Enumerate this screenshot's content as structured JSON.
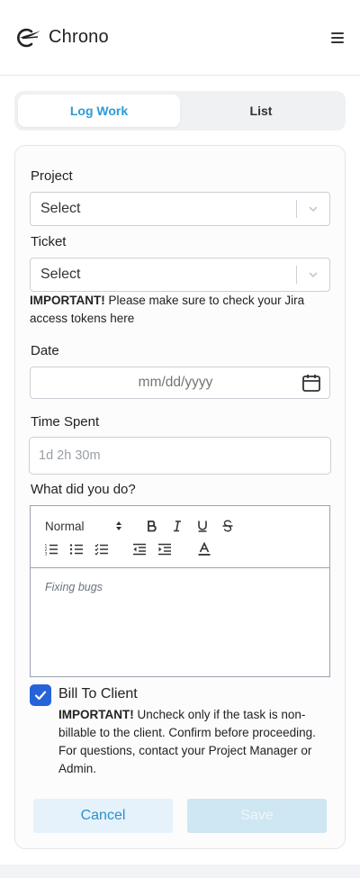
{
  "app": {
    "title": "Chrono"
  },
  "tabs": [
    {
      "label": "Log Work",
      "active": true
    },
    {
      "label": "List",
      "active": false
    }
  ],
  "form": {
    "project": {
      "label": "Project",
      "value": "Select"
    },
    "ticket": {
      "label": "Ticket",
      "value": "Select"
    },
    "jira_note": {
      "strong": "IMPORTANT!",
      "text": " Please make sure to check your Jira access tokens here"
    },
    "date": {
      "label": "Date",
      "placeholder": "mm/dd/yyyy"
    },
    "time_spent": {
      "label": "Time Spent",
      "placeholder": "1d 2h 30m"
    },
    "description": {
      "label": "What did you do?",
      "format_select": "Normal",
      "placeholder": "Fixing bugs"
    },
    "bill_to_client": {
      "label": "Bill To Client",
      "checked": true,
      "note_strong": "IMPORTANT!",
      "note_text": " Uncheck only if the task is non-billable to the client. Confirm before proceeding. For questions, contact your Project Manager or Admin."
    },
    "buttons": {
      "cancel": "Cancel",
      "save": "Save"
    }
  },
  "colors": {
    "accent": "#2b9bd8",
    "checkbox": "#2563d9",
    "cancel_bg": "#e6f2fb",
    "save_bg": "#cfe6f3"
  }
}
